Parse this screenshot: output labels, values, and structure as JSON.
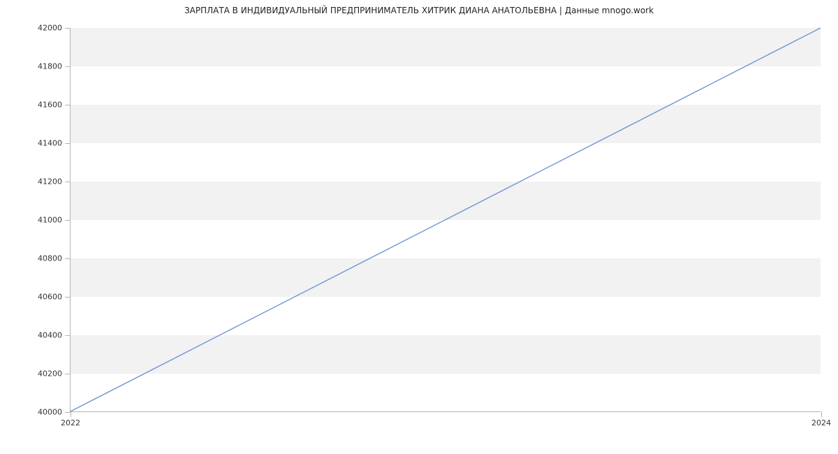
{
  "chart_data": {
    "type": "line",
    "title": "ЗАРПЛАТА В ИНДИВИДУАЛЬНЫЙ ПРЕДПРИНИМАТЕЛЬ ХИТРИК ДИАНА АНАТОЛЬЕВНА | Данные mnogo.work",
    "xlabel": "",
    "ylabel": "",
    "x": [
      2022,
      2024
    ],
    "y": [
      40000,
      42000
    ],
    "x_ticks": [
      2022,
      2024
    ],
    "y_ticks": [
      40000,
      40200,
      40400,
      40600,
      40800,
      41000,
      41200,
      41400,
      41600,
      41800,
      42000
    ],
    "xlim": [
      2022,
      2024
    ],
    "ylim": [
      40000,
      42000
    ],
    "line_color": "#6f95d3",
    "grid": true
  }
}
